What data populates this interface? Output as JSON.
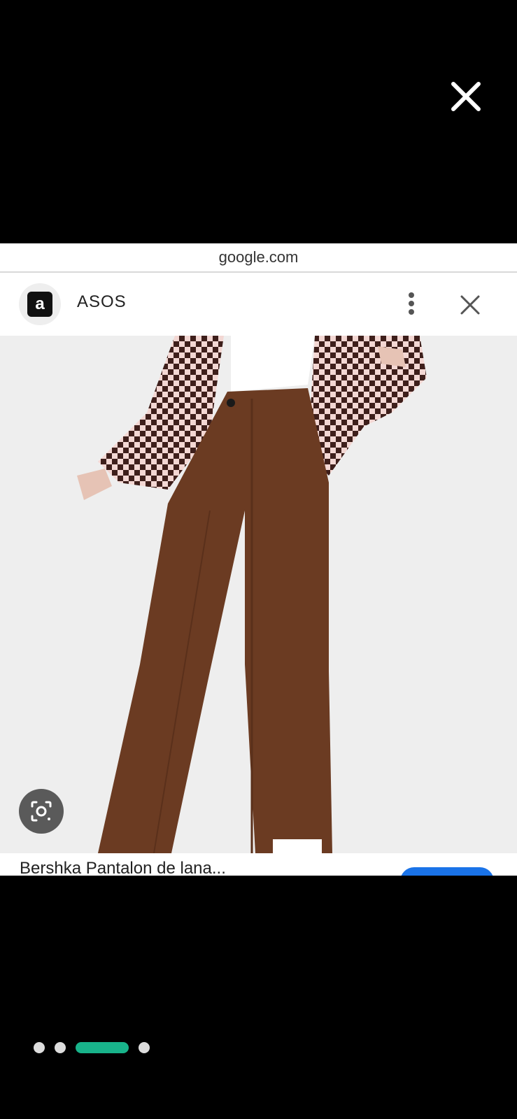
{
  "overlay": {
    "close_icon": "close-icon",
    "url": "google.com"
  },
  "card": {
    "brand_name": "ASOS",
    "logo_letter": "a",
    "menu_icon": "more-vert-icon",
    "close_icon": "close-icon",
    "snippet_text": "Bershka Pantalon de lana..."
  },
  "lens": {
    "icon": "google-lens-icon"
  },
  "pager": {
    "count": 4,
    "active_index": 2,
    "active_color": "#18b38a"
  }
}
